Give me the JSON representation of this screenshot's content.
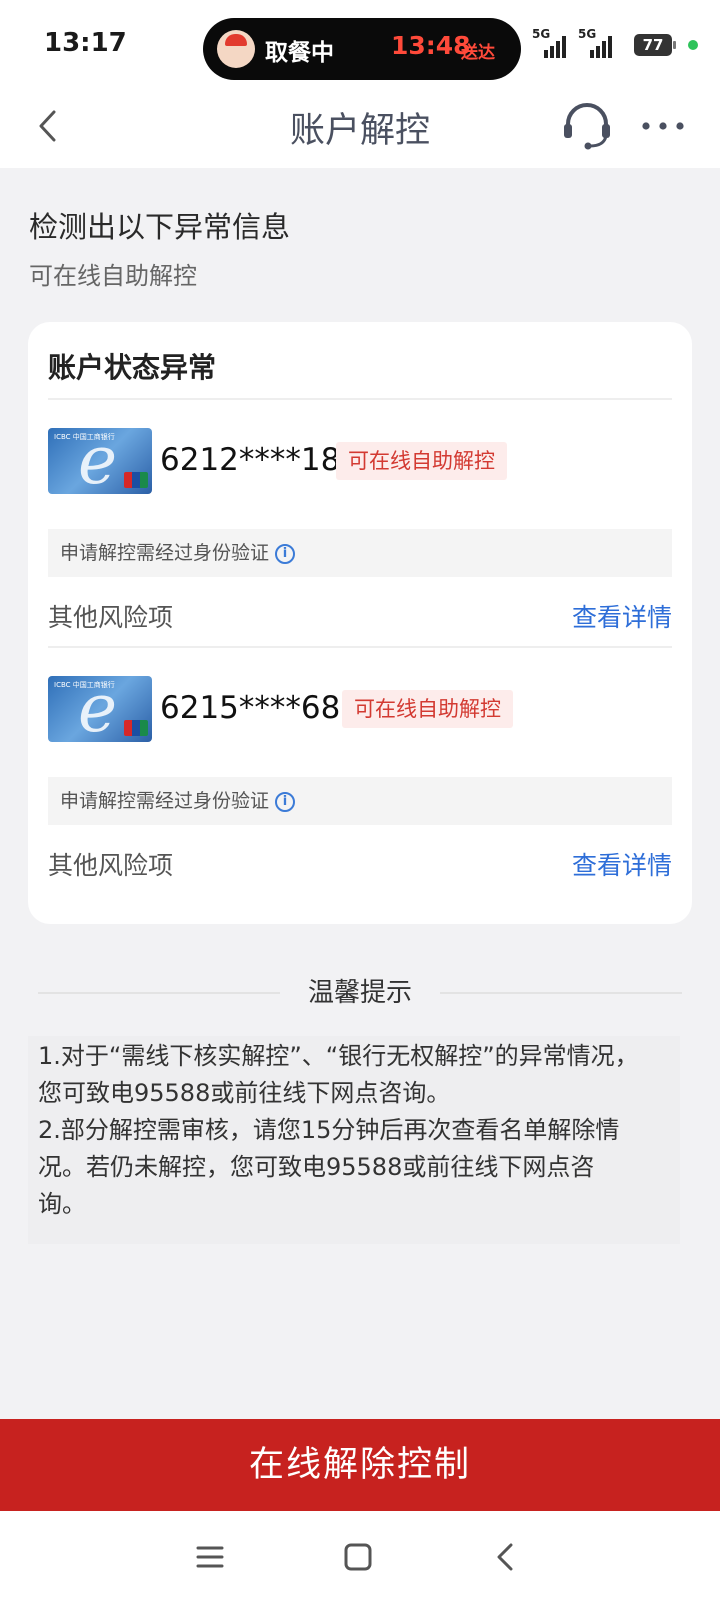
{
  "status_bar": {
    "time": "13:17",
    "live_status": "取餐中",
    "live_eta": "13:48",
    "live_deliver": "送达",
    "network_1": "5G",
    "network_2": "5G",
    "battery": "77"
  },
  "nav": {
    "title": "账户解控",
    "back_icon": "chevron-left-icon",
    "service_icon": "headset-icon",
    "more_icon": "more-icon"
  },
  "intro": {
    "heading": "检测出以下异常信息",
    "subheading": "可在线自助解控"
  },
  "card": {
    "title": "账户状态异常",
    "accounts": [
      {
        "number": "6212****1836",
        "tag": "可在线自助解控",
        "notice": "申请解控需经过身份验证",
        "risk_label": "其他风险项",
        "risk_link": "查看详情"
      },
      {
        "number": "6215****6835",
        "tag": "可在线自助解控",
        "notice": "申请解控需经过身份验证",
        "risk_label": "其他风险项",
        "risk_link": "查看详情"
      }
    ]
  },
  "tips": {
    "title": "温馨提示",
    "lines": [
      "1.对于“需线下核实解控”、“银行无权解控”的异常情况，",
      "您可致电95588或前往线下网点咨询。",
      "2.部分解控需审核，请您15分钟后再次查看名单解除情",
      "况。若仍未解控，您可致电95588或前往线下网点咨",
      "询。"
    ]
  },
  "cta": {
    "label": "在线解除控制"
  },
  "colors": {
    "accent_red": "#c7221f",
    "link_blue": "#2e6ed8",
    "tag_red": "#d33a32"
  }
}
